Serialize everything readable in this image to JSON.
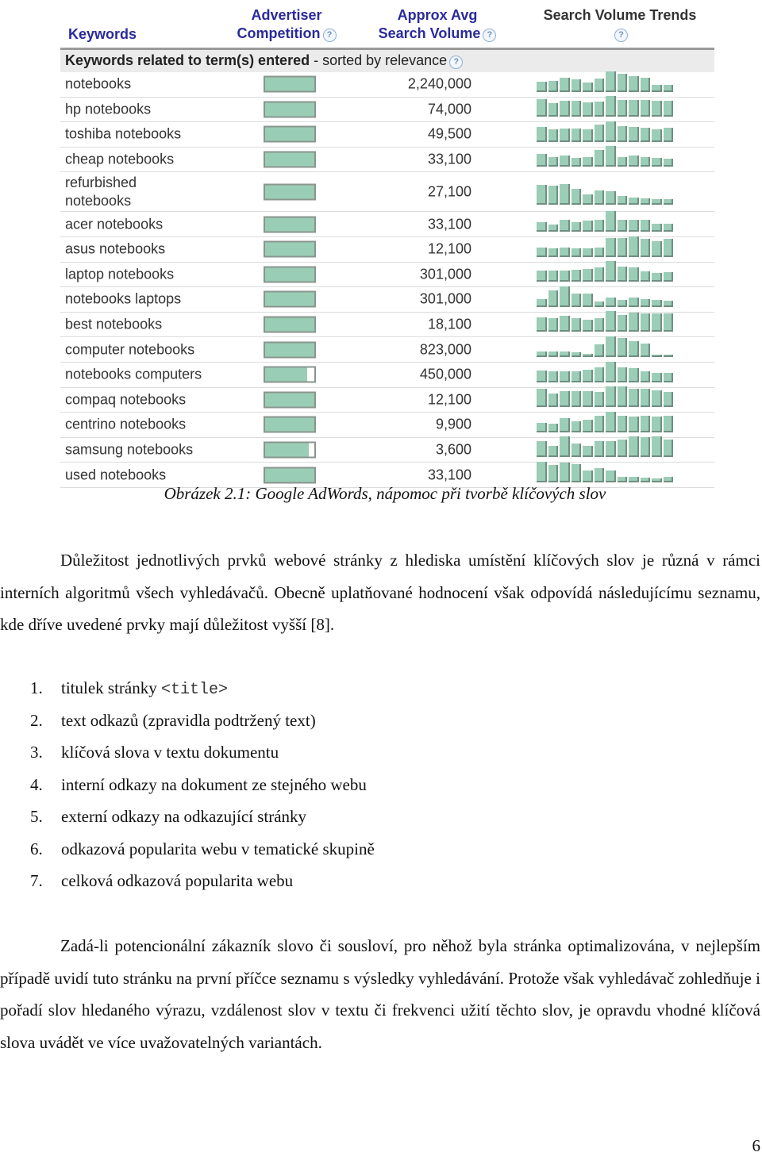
{
  "figure": {
    "headers": {
      "keywords": "Keywords",
      "competition_line1": "Advertiser",
      "competition_line2": "Competition",
      "volume_line1": "Approx Avg",
      "volume_line2": "Search Volume",
      "trends_line1": "Search Volume Trends",
      "help_glyph": "?"
    },
    "section_title_bold": "Keywords related to term(s) entered",
    "section_title_rest": " - sorted by relevance",
    "colors": {
      "header_link": "#2a2a9a",
      "bar_fill": "#9acdb5",
      "section_bg": "#ebebeb"
    },
    "rows": [
      {
        "keyword": "notebooks",
        "competition": 1.0,
        "volume": "2,240,000",
        "trend": [
          0.5,
          0.55,
          0.68,
          0.6,
          0.45,
          0.65,
          1.0,
          0.9,
          0.78,
          0.68,
          0.36,
          0.34
        ]
      },
      {
        "keyword": "hp notebooks",
        "competition": 1.0,
        "volume": "74,000",
        "trend": [
          0.85,
          0.65,
          0.78,
          0.78,
          0.68,
          0.72,
          1.0,
          0.8,
          0.8,
          0.8,
          0.78,
          0.78
        ]
      },
      {
        "keyword": "toshiba notebooks",
        "competition": 1.0,
        "volume": "49,500",
        "trend": [
          0.72,
          0.6,
          0.66,
          0.66,
          0.6,
          0.86,
          1.0,
          0.76,
          0.72,
          0.68,
          0.62,
          0.7
        ]
      },
      {
        "keyword": "cheap notebooks",
        "competition": 1.0,
        "volume": "33,100",
        "trend": [
          0.62,
          0.46,
          0.54,
          0.42,
          0.48,
          0.82,
          1.0,
          0.48,
          0.54,
          0.48,
          0.44,
          0.38
        ]
      },
      {
        "keyword": "refurbished notebooks",
        "competition": 1.0,
        "volume": "27,100",
        "trend": [
          0.96,
          0.94,
          1.0,
          0.76,
          0.5,
          0.7,
          0.66,
          0.42,
          0.36,
          0.3,
          0.26,
          0.26
        ]
      },
      {
        "keyword": "acer notebooks",
        "competition": 1.0,
        "volume": "33,100",
        "trend": [
          0.48,
          0.36,
          0.56,
          0.48,
          0.54,
          0.58,
          1.0,
          0.58,
          0.56,
          0.56,
          0.4,
          0.4
        ]
      },
      {
        "keyword": "asus notebooks",
        "competition": 1.0,
        "volume": "12,100",
        "trend": [
          0.45,
          0.42,
          0.46,
          0.42,
          0.42,
          0.45,
          0.93,
          0.93,
          1.0,
          0.88,
          0.78,
          0.9
        ]
      },
      {
        "keyword": "laptop notebooks",
        "competition": 1.0,
        "volume": "301,000",
        "trend": [
          0.55,
          0.52,
          0.52,
          0.58,
          0.6,
          0.68,
          1.0,
          0.72,
          0.68,
          0.5,
          0.42,
          0.48
        ]
      },
      {
        "keyword": "notebooks laptops",
        "competition": 1.0,
        "volume": "301,000",
        "trend": [
          0.4,
          0.82,
          1.0,
          0.64,
          0.64,
          0.28,
          0.48,
          0.36,
          0.48,
          0.38,
          0.34,
          0.32
        ]
      },
      {
        "keyword": "best notebooks",
        "competition": 1.0,
        "volume": "18,100",
        "trend": [
          0.68,
          0.64,
          0.78,
          0.65,
          0.58,
          0.64,
          1.0,
          0.82,
          0.94,
          0.9,
          0.9,
          0.9
        ]
      },
      {
        "keyword": "computer notebooks",
        "competition": 1.0,
        "volume": "823,000",
        "trend": [
          0.28,
          0.28,
          0.28,
          0.22,
          0.16,
          0.6,
          1.0,
          0.94,
          0.78,
          0.66,
          0.1,
          0.1
        ]
      },
      {
        "keyword": "notebooks computers",
        "competition": 0.85,
        "volume": "450,000",
        "trend": [
          0.58,
          0.54,
          0.54,
          0.54,
          0.6,
          0.72,
          1.0,
          0.72,
          0.68,
          0.54,
          0.48,
          0.48
        ]
      },
      {
        "keyword": "compaq notebooks",
        "competition": 1.0,
        "volume": "12,100",
        "trend": [
          0.9,
          0.64,
          0.76,
          0.76,
          0.76,
          0.72,
          1.0,
          1.0,
          0.9,
          0.9,
          0.82,
          0.72
        ]
      },
      {
        "keyword": "centrino notebooks",
        "competition": 1.0,
        "volume": "9,900",
        "trend": [
          0.47,
          0.42,
          0.68,
          0.54,
          0.6,
          0.82,
          1.0,
          0.8,
          0.78,
          0.8,
          0.78,
          0.8
        ]
      },
      {
        "keyword": "samsung notebooks",
        "competition": 0.88,
        "volume": "3,600",
        "trend": [
          0.76,
          0.52,
          1.0,
          0.64,
          0.52,
          0.76,
          0.76,
          0.86,
          1.0,
          0.96,
          1.0,
          0.86
        ]
      },
      {
        "keyword": "used notebooks",
        "competition": 1.0,
        "volume": "33,100",
        "trend": [
          1.0,
          0.84,
          0.98,
          0.9,
          0.58,
          0.7,
          0.58,
          0.28,
          0.28,
          0.22,
          0.2,
          0.28
        ]
      }
    ]
  },
  "caption": "Obrázek 2.1: Google AdWords, nápomoc při tvorbě klíčových slov",
  "paragraph1": "Důležitost jednotlivých prvků webové stránky z hlediska umístění klíčových slov je různá v rámci interních algoritmů všech vyhledávačů. Obecně uplatňované hodnocení však odpovídá následujícímu seznamu, kde dříve uvedené prvky mají důležitost vyšší [8].",
  "list": [
    {
      "num": "1.",
      "text": "titulek stránky ",
      "code": "<title>"
    },
    {
      "num": "2.",
      "text": "text odkazů (zpravidla podtržený text)"
    },
    {
      "num": "3.",
      "text": "klíčová slova v textu dokumentu"
    },
    {
      "num": "4.",
      "text": "interní odkazy na dokument ze stejného webu"
    },
    {
      "num": "5.",
      "text": "externí odkazy na odkazující stránky"
    },
    {
      "num": "6.",
      "text": "odkazová popularita webu v tematické skupině"
    },
    {
      "num": "7.",
      "text": "celková odkazová popularita webu"
    }
  ],
  "paragraph2": "Zadá-li potencionální zákazník slovo či sousloví, pro něhož byla stránka optimalizována, v nejlepším případě uvidí tuto stránku na první příčce seznamu s výsledky vyhledávání. Protože však vyhledávač zohledňuje i pořadí slov hledaného výrazu, vzdálenost slov v textu či frekvenci užití těchto slov, je opravdu vhodné klíčová slova uvádět ve více uvažovatelných variantách.",
  "page_number": "6"
}
